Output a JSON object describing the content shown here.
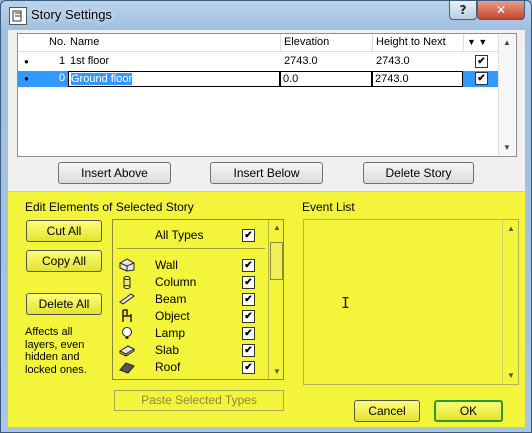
{
  "window": {
    "title": "Story Settings",
    "help_label": "?",
    "close_label": "✕"
  },
  "story_list": {
    "columns": {
      "no": "No.",
      "name": "Name",
      "elevation": "Elevation",
      "height": "Height to Next"
    },
    "rows": [
      {
        "bullet": "●",
        "no": "1",
        "name": "1st floor",
        "elevation": "2743.0",
        "height": "2743.0",
        "checked": "✔"
      },
      {
        "bullet": "●",
        "no": "0",
        "name": "Ground floor",
        "elevation": "0.0",
        "height": "2743.0",
        "checked": "✔"
      }
    ]
  },
  "buttons": {
    "insert_above": "Insert Above",
    "insert_below": "Insert Below",
    "delete_story": "Delete Story"
  },
  "edit_elements": {
    "heading": "Edit Elements of Selected Story",
    "cut_all": "Cut All",
    "copy_all": "Copy All",
    "delete_all": "Delete All",
    "note": "Affects all layers, even hidden and locked ones.",
    "all_types": "All Types",
    "types": [
      {
        "name": "Wall",
        "icon": "wall-icon"
      },
      {
        "name": "Column",
        "icon": "column-icon"
      },
      {
        "name": "Beam",
        "icon": "beam-icon"
      },
      {
        "name": "Object",
        "icon": "object-icon"
      },
      {
        "name": "Lamp",
        "icon": "lamp-icon"
      },
      {
        "name": "Slab",
        "icon": "slab-icon"
      },
      {
        "name": "Roof",
        "icon": "roof-icon"
      }
    ],
    "paste_selected": "Paste Selected Types"
  },
  "event_list": {
    "heading": "Event List"
  },
  "dialog": {
    "cancel": "Cancel",
    "ok": "OK"
  },
  "colors": {
    "accent_yellow": "#f4f43a",
    "selection_blue": "#3399ff",
    "ok_border": "#2a9a2a"
  }
}
